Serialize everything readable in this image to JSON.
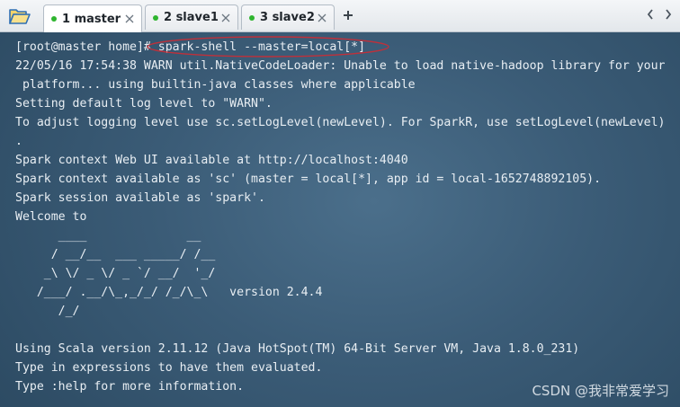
{
  "tabs": [
    {
      "label": "1 master",
      "active": true
    },
    {
      "label": "2 slave1",
      "active": false
    },
    {
      "label": "3 slave2",
      "active": false
    }
  ],
  "colors": {
    "tab_status_dot": "#2fb52f",
    "highlight_circle": "#c0303a",
    "terminal_text": "#e8eef3"
  },
  "icons": {
    "open_folder": "folder-open-icon",
    "add_tab": "plus-icon",
    "tab_close": "close-icon"
  },
  "terminal": {
    "lines": [
      "[root@master home]# spark-shell --master=local[*]",
      "22/05/16 17:54:38 WARN util.NativeCodeLoader: Unable to load native-hadoop library for your",
      " platform... using builtin-java classes where applicable",
      "Setting default log level to \"WARN\".",
      "To adjust logging level use sc.setLogLevel(newLevel). For SparkR, use setLogLevel(newLevel)",
      ".",
      "Spark context Web UI available at http://localhost:4040",
      "Spark context available as 'sc' (master = local[*], app id = local-1652748892105).",
      "Spark session available as 'spark'.",
      "Welcome to",
      "      ____              __",
      "     / __/__  ___ _____/ /__",
      "    _\\ \\/ _ \\/ _ `/ __/  '_/",
      "   /___/ .__/\\_,_/_/ /_/\\_\\   version 2.4.4",
      "      /_/",
      "",
      "Using Scala version 2.11.12 (Java HotSpot(TM) 64-Bit Server VM, Java 1.8.0_231)",
      "Type in expressions to have them evaluated.",
      "Type :help for more information."
    ]
  },
  "watermark": "CSDN @我非常爱学习"
}
